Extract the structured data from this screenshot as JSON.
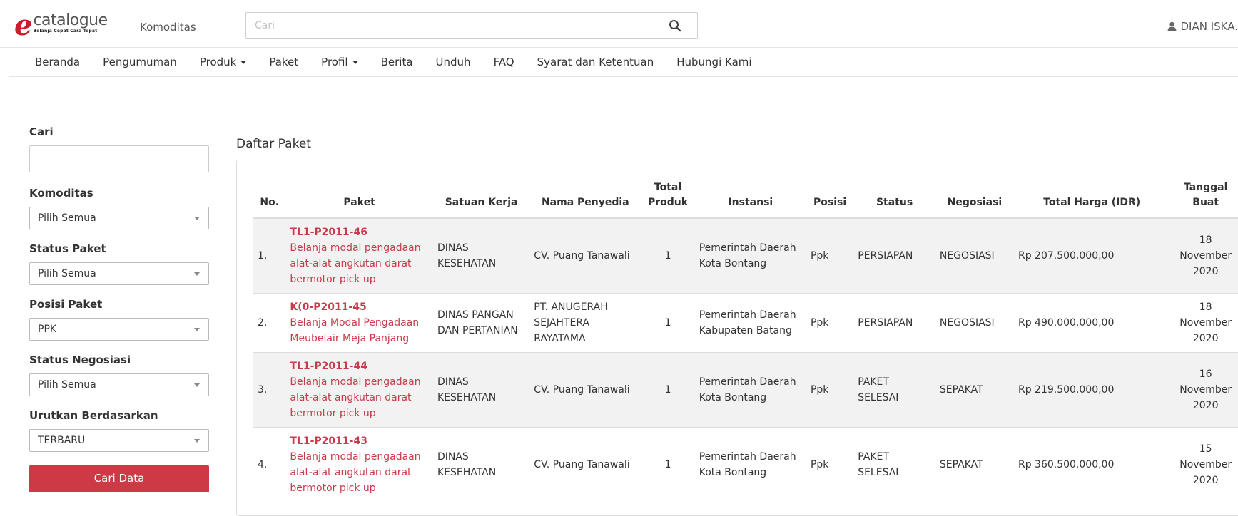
{
  "header": {
    "logo_word": "catalogue",
    "logo_tagline": "Belanja Cepat Cara Tepat",
    "komoditas_label": "Komoditas",
    "search_placeholder": "Cari",
    "user_name": "DIAN ISKA."
  },
  "nav": {
    "items": [
      {
        "label": "Beranda",
        "dropdown": false
      },
      {
        "label": "Pengumuman",
        "dropdown": false
      },
      {
        "label": "Produk",
        "dropdown": true
      },
      {
        "label": "Paket",
        "dropdown": false
      },
      {
        "label": "Profil",
        "dropdown": true
      },
      {
        "label": "Berita",
        "dropdown": false
      },
      {
        "label": "Unduh",
        "dropdown": false
      },
      {
        "label": "FAQ",
        "dropdown": false
      },
      {
        "label": "Syarat dan Ketentuan",
        "dropdown": false
      },
      {
        "label": "Hubungi Kami",
        "dropdown": false
      }
    ]
  },
  "sidebar": {
    "cari_label": "Cari",
    "cari_value": "",
    "komoditas_label": "Komoditas",
    "komoditas_value": "Pilih Semua",
    "status_paket_label": "Status Paket",
    "status_paket_value": "Pilih Semua",
    "posisi_paket_label": "Posisi Paket",
    "posisi_paket_value": "PPK",
    "status_negosiasi_label": "Status Negosiasi",
    "status_negosiasi_value": "Pilih Semua",
    "urutkan_label": "Urutkan Berdasarkan",
    "urutkan_value": "TERBARU",
    "cari_button": "Cari Data"
  },
  "main": {
    "title": "Daftar Paket",
    "columns": {
      "no": "No.",
      "paket": "Paket",
      "satker": "Satuan Kerja",
      "penyedia": "Nama Penyedia",
      "total_a": "Total",
      "total_b": "Produk",
      "instansi": "Instansi",
      "posisi": "Posisi",
      "status": "Status",
      "negosiasi": "Negosiasi",
      "harga": "Total Harga (IDR)",
      "tanggal_a": "Tanggal",
      "tanggal_b": "Buat"
    },
    "rows": [
      {
        "no": "1.",
        "code": "TL1-P2011-46",
        "name": "Belanja modal pengadaan alat-alat angkutan darat bermotor pick up",
        "satker": "DINAS KESEHATAN",
        "penyedia": "CV. Puang Tanawali",
        "total": "1",
        "instansi": "Pemerintah Daerah Kota Bontang",
        "posisi": "Ppk",
        "status": "PERSIAPAN",
        "negosiasi": "NEGOSIASI",
        "harga": "Rp 207.500.000,00",
        "tgl_day": "18",
        "tgl_month": "November",
        "tgl_year": "2020"
      },
      {
        "no": "2.",
        "code": "K(0-P2011-45",
        "name": "Belanja Modal Pengadaan Meubelair Meja Panjang",
        "satker": "DINAS PANGAN DAN PERTANIAN",
        "penyedia": "PT. ANUGERAH SEJAHTERA RAYATAMA",
        "total": "1",
        "instansi": "Pemerintah Daerah Kabupaten Batang",
        "posisi": "Ppk",
        "status": "PERSIAPAN",
        "negosiasi": "NEGOSIASI",
        "harga": "Rp 490.000.000,00",
        "tgl_day": "18",
        "tgl_month": "November",
        "tgl_year": "2020"
      },
      {
        "no": "3.",
        "code": "TL1-P2011-44",
        "name": "Belanja modal pengadaan alat-alat angkutan darat bermotor pick up",
        "satker": "DINAS KESEHATAN",
        "penyedia": "CV. Puang Tanawali",
        "total": "1",
        "instansi": "Pemerintah Daerah Kota Bontang",
        "posisi": "Ppk",
        "status": "PAKET SELESAI",
        "negosiasi": "SEPAKAT",
        "harga": "Rp 219.500.000,00",
        "tgl_day": "16",
        "tgl_month": "November",
        "tgl_year": "2020"
      },
      {
        "no": "4.",
        "code": "TL1-P2011-43",
        "name": "Belanja modal pengadaan alat-alat angkutan darat bermotor pick up",
        "satker": "DINAS KESEHATAN",
        "penyedia": "CV. Puang Tanawali",
        "total": "1",
        "instansi": "Pemerintah Daerah Kota Bontang",
        "posisi": "Ppk",
        "status": "PAKET SELESAI",
        "negosiasi": "SEPAKAT",
        "harga": "Rp 360.500.000,00",
        "tgl_day": "15",
        "tgl_month": "November",
        "tgl_year": "2020"
      }
    ]
  },
  "colors": {
    "brand_red": "#c81e2b",
    "link_red": "#c93a4a",
    "button_red": "#cd3a45",
    "row_stripe": "#f2f2f2"
  }
}
